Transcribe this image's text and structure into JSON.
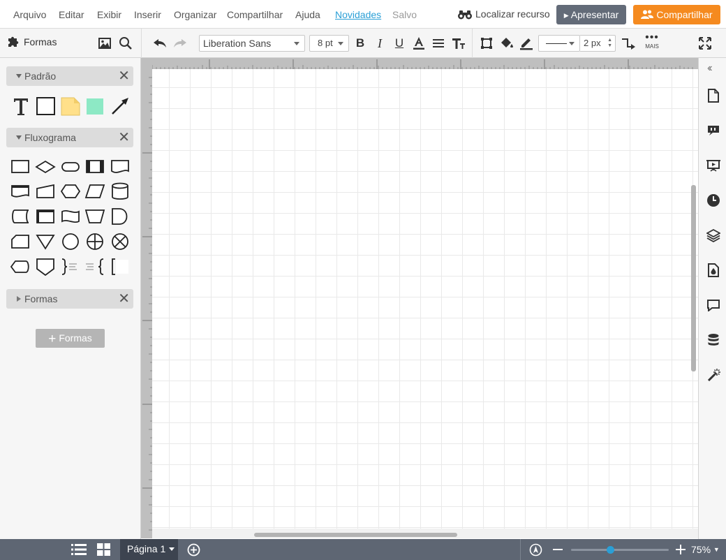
{
  "menu": {
    "items": [
      "Arquivo",
      "Editar",
      "Exibir",
      "Inserir",
      "Organizar",
      "Compartilhar",
      "Ajuda"
    ],
    "news": "Novidades",
    "saved": "Salvo",
    "find_resource": "Localizar recurso",
    "present": "Apresentar",
    "share": "Compartilhar"
  },
  "toolbar": {
    "shapes_label": "Formas",
    "font": "Liberation Sans",
    "font_size": "8 pt",
    "stroke_width": "2 px",
    "more_label": "MAIS"
  },
  "panel": {
    "sections": [
      {
        "label": "Padrão",
        "expanded": true
      },
      {
        "label": "Fluxograma",
        "expanded": true
      },
      {
        "label": "Formas",
        "expanded": false
      }
    ],
    "add_shapes_label": "Formas"
  },
  "footer": {
    "page_label": "Página 1",
    "zoom": "75%"
  },
  "colors": {
    "accent": "#2a9fd6",
    "share": "#f58a1f",
    "present": "#636b78",
    "statusbar": "#5e6673",
    "note": "#ffe08a",
    "fill_shape": "#8de9c5"
  }
}
